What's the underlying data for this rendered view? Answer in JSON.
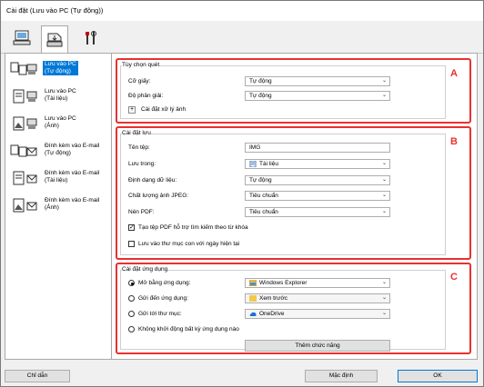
{
  "window": {
    "title": "Cài đặt (Lưu vào PC (Tự động))"
  },
  "toolbar": {
    "tabs": [
      {
        "icon": "scan-from-computer-icon"
      },
      {
        "icon": "scan-from-panel-icon"
      },
      {
        "icon": "general-settings-icon"
      }
    ]
  },
  "sidebar": {
    "items": [
      {
        "label": "Lưu vào PC\n(Tự động)",
        "icon": "save-to-pc-auto-icon"
      },
      {
        "label": "Lưu vào PC\n(Tài liệu)",
        "icon": "save-to-pc-document-icon"
      },
      {
        "label": "Lưu vào PC\n(Ảnh)",
        "icon": "save-to-pc-photo-icon"
      },
      {
        "label": "Đính kèm vào E-mail\n(Tự động)",
        "icon": "attach-email-auto-icon"
      },
      {
        "label": "Đính kèm vào E-mail\n(Tài liệu)",
        "icon": "attach-email-document-icon"
      },
      {
        "label": "Đính kèm vào E-mail\n(Ảnh)",
        "icon": "attach-email-photo-icon"
      }
    ]
  },
  "scan_options": {
    "title": "Tùy chọn quét",
    "letter": "A",
    "paper_size_label": "Cỡ giấy:",
    "paper_size_value": "Tự động",
    "resolution_label": "Độ phân giải:",
    "resolution_value": "Tự động",
    "image_processing_label": "Cài đặt xử lý ảnh"
  },
  "save_settings": {
    "title": "Cài đặt lưu",
    "letter": "B",
    "file_name_label": "Tên tệp:",
    "file_name_value": "IMG",
    "save_in_label": "Lưu trong:",
    "save_in_value": "Tài liệu",
    "data_format_label": "Định dạng dữ liệu:",
    "data_format_value": "Tự động",
    "jpeg_quality_label": "Chất lượng ảnh JPEG:",
    "jpeg_quality_value": "Tiêu chuẩn",
    "pdf_compression_label": "Nén PDF:",
    "pdf_compression_value": "Tiêu chuẩn",
    "keyword_pdf_label": "Tạo tệp PDF hỗ trợ tìm kiếm theo từ khóa",
    "keyword_pdf_checked": true,
    "subfolder_label": "Lưu vào thư mục con với ngày hiện tại",
    "subfolder_checked": false
  },
  "app_settings": {
    "title": "Cài đặt ứng dụng",
    "letter": "C",
    "open_with_label": "Mở bằng ứng dụng:",
    "open_with_value": "Windows Explorer",
    "send_to_app_label": "Gửi đến ứng dụng:",
    "send_to_app_value": "Xem trước",
    "send_to_folder_label": "Gửi tới thư mục:",
    "send_to_folder_value": "OneDrive",
    "no_app_label": "Không khởi động bất kỳ ứng dụng nào",
    "add_button": "Thêm chức năng",
    "selected": "open_with"
  },
  "footer": {
    "help": "Chỉ dẫn",
    "defaults": "Mặc định",
    "ok": "OK"
  },
  "colors": {
    "accent": "#0078d7",
    "highlight": "#e8312f"
  }
}
